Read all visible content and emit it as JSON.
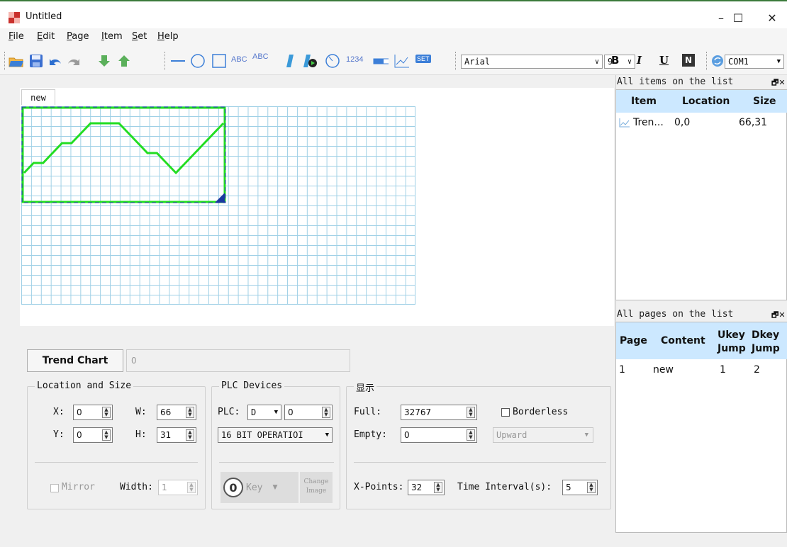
{
  "window": {
    "title": "Untitled",
    "minimize": "–",
    "maximize": "☐",
    "close": "✕"
  },
  "menu": [
    {
      "key": "F",
      "rest": "ile"
    },
    {
      "key": "E",
      "rest": "dit"
    },
    {
      "key": "P",
      "rest": "age"
    },
    {
      "key": "I",
      "rest": "tem"
    },
    {
      "key": "S",
      "rest": "et"
    },
    {
      "key": "H",
      "rest": "elp"
    }
  ],
  "toolbar": {
    "text_abc": "ABC",
    "text_abc2": "ABC",
    "text_1234": "1234",
    "text_set": "SET",
    "font_name": "Arial",
    "font_size": "9",
    "bold": "B",
    "italic": "I",
    "underline": "U",
    "normal": "N",
    "port": "COM1"
  },
  "canvas": {
    "tab": "new"
  },
  "trend_chart_values": [
    6,
    5,
    5,
    4,
    3,
    3,
    2,
    1,
    1,
    1,
    1,
    2,
    3,
    4,
    4,
    5,
    6,
    5,
    4,
    3,
    2,
    1
  ],
  "props": {
    "item_type": "Trend Chart",
    "item_value": "0",
    "location": {
      "legend": "Location and Size",
      "x_label": "X:",
      "x": "0",
      "y_label": "Y:",
      "y": "0",
      "w_label": "W:",
      "w": "66",
      "h_label": "H:",
      "h": "31",
      "mirror": "Mirror",
      "width_label": "Width:",
      "width": "1"
    },
    "plc": {
      "legend": "PLC Devices",
      "plc_label": "PLC:",
      "device": "D",
      "address": "0",
      "operation": "16 BIT OPERATIOI",
      "key_icon": "0",
      "key": "Key",
      "change": "Change",
      "image": "Image"
    },
    "display": {
      "legend": "显示",
      "full_label": "Full:",
      "full": "32767",
      "empty_label": "Empty:",
      "empty": "0",
      "borderless": "Borderless",
      "direction": "Upward",
      "xpoints_label": "X-Points:",
      "xpoints": "32",
      "interval_label": "Time Interval(s):",
      "interval": "5"
    }
  },
  "items_panel": {
    "title": "All items on the list",
    "headers": [
      "Item",
      "Location",
      "Size"
    ],
    "rows": [
      {
        "item": "Tren...",
        "location": "0,0",
        "size": "66,31"
      }
    ]
  },
  "pages_panel": {
    "title": "All pages on the list",
    "headers": [
      "Page",
      "Content",
      "Ukey",
      "Jump",
      "Dkey",
      "Jump"
    ],
    "rows": [
      {
        "page": "1",
        "content": "new",
        "ukey": "1",
        "dkey": "2"
      }
    ]
  },
  "colors": {
    "trend_line": "#22dd22",
    "grid": "#9fd0e6",
    "header_bg": "#cce8ff"
  }
}
